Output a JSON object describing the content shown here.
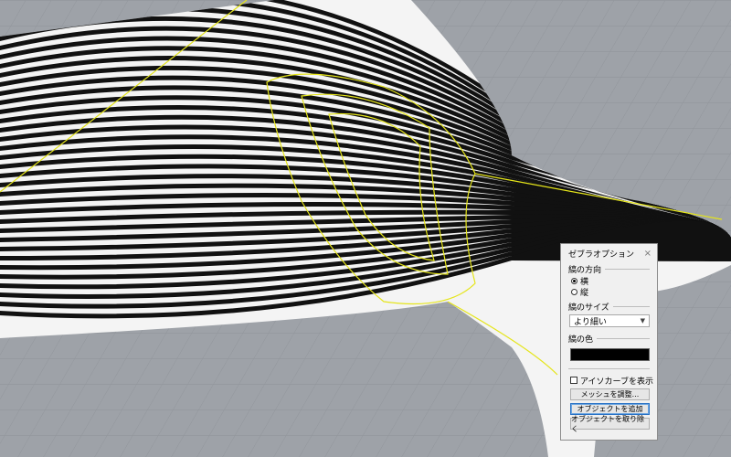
{
  "panel": {
    "title": "ゼブラオプション",
    "close_glyph": "×",
    "direction_section": "縞の方向",
    "direction_options": [
      {
        "label": "横",
        "selected": true
      },
      {
        "label": "縦",
        "selected": false
      }
    ],
    "size_section": "縞のサイズ",
    "size_value": "より細い",
    "color_section": "縞の色",
    "stripe_color": "#000000",
    "show_isocurves_label": "アイソカーブを表示",
    "adjust_mesh_label": "メッシュを調整...",
    "add_objects_label": "オブジェクトを追加",
    "remove_objects_label": "オブジェクトを取り除く"
  },
  "icons": {
    "close": "close-icon",
    "dropdown": "chevron-down-icon"
  },
  "colors": {
    "viewport_bg": "#9ea2a8",
    "grid": "#8d9197",
    "edge_highlight": "#e5e51a",
    "panel_bg": "#f0f0f0"
  }
}
